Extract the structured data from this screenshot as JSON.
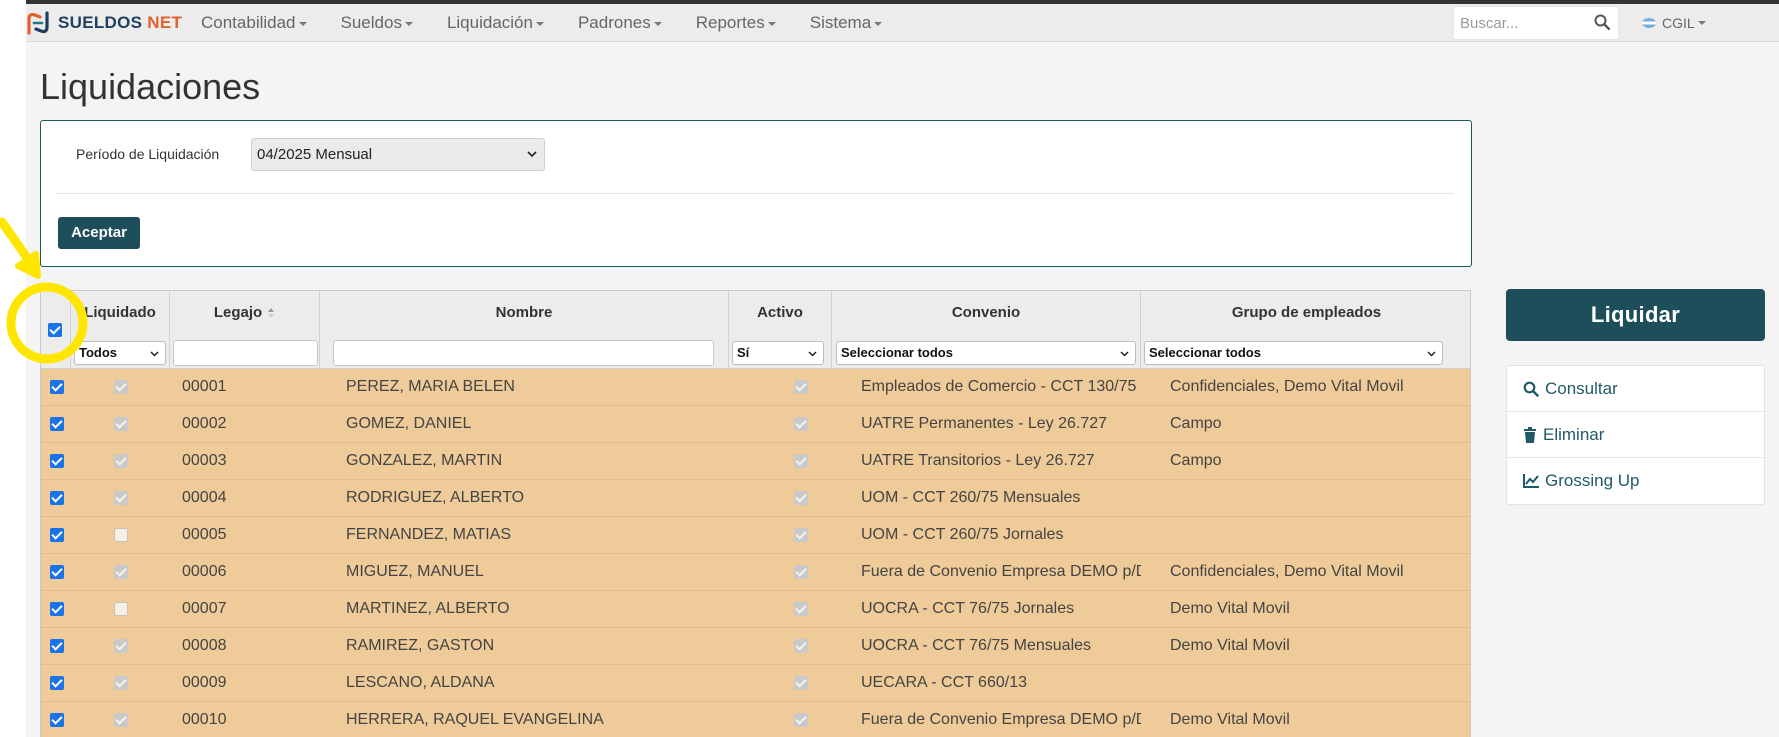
{
  "navbar": {
    "logo_part1": "SUELDOS",
    "logo_part2": " NET",
    "menu": [
      {
        "label": "Contabilidad"
      },
      {
        "label": "Sueldos"
      },
      {
        "label": "Liquidación"
      },
      {
        "label": "Padrones"
      },
      {
        "label": "Reportes"
      },
      {
        "label": "Sistema"
      }
    ],
    "search_placeholder": "Buscar...",
    "user_label": "CGIL"
  },
  "page": {
    "title": "Liquidaciones"
  },
  "filter": {
    "period_label": "Período de Liquidación",
    "period_value": "04/2025 Mensual",
    "accept_label": "Aceptar"
  },
  "table": {
    "headers": {
      "liquidado": "Liquidado",
      "legajo": "Legajo",
      "nombre": "Nombre",
      "activo": "Activo",
      "convenio": "Convenio",
      "grupo": "Grupo de empleados"
    },
    "filters": {
      "liquidado": "Todos",
      "activo": "Sí",
      "convenio": "Seleccionar todos",
      "grupo": "Seleccionar todos"
    },
    "rows": [
      {
        "selected": true,
        "liquidado": true,
        "legajo": "00001",
        "nombre": "PEREZ, MARIA BELEN",
        "activo": true,
        "convenio": "Empleados de Comercio - CCT 130/75",
        "grupo": "Confidenciales, Demo Vital Movil"
      },
      {
        "selected": true,
        "liquidado": true,
        "legajo": "00002",
        "nombre": "GOMEZ, DANIEL",
        "activo": true,
        "convenio": "UATRE Permanentes - Ley 26.727",
        "grupo": "Campo"
      },
      {
        "selected": true,
        "liquidado": true,
        "legajo": "00003",
        "nombre": "GONZALEZ, MARTIN",
        "activo": true,
        "convenio": "UATRE Transitorios - Ley 26.727",
        "grupo": "Campo"
      },
      {
        "selected": true,
        "liquidado": true,
        "legajo": "00004",
        "nombre": "RODRIGUEZ, ALBERTO",
        "activo": true,
        "convenio": "UOM - CCT 260/75 Mensuales",
        "grupo": ""
      },
      {
        "selected": true,
        "liquidado": false,
        "legajo": "00005",
        "nombre": "FERNANDEZ, MATIAS",
        "activo": true,
        "convenio": "UOM - CCT 260/75 Jornales",
        "grupo": ""
      },
      {
        "selected": true,
        "liquidado": true,
        "legajo": "00006",
        "nombre": "MIGUEZ, MANUEL",
        "activo": true,
        "convenio": "Fuera de Convenio Empresa DEMO p/Demo",
        "grupo": "Confidenciales, Demo Vital Movil"
      },
      {
        "selected": true,
        "liquidado": false,
        "legajo": "00007",
        "nombre": "MARTINEZ, ALBERTO",
        "activo": true,
        "convenio": "UOCRA - CCT 76/75 Jornales",
        "grupo": "Demo Vital Movil"
      },
      {
        "selected": true,
        "liquidado": true,
        "legajo": "00008",
        "nombre": "RAMIREZ, GASTON",
        "activo": true,
        "convenio": "UOCRA - CCT 76/75 Mensuales",
        "grupo": "Demo Vital Movil"
      },
      {
        "selected": true,
        "liquidado": true,
        "legajo": "00009",
        "nombre": "LESCANO, ALDANA",
        "activo": true,
        "convenio": "UECARA - CCT 660/13",
        "grupo": ""
      },
      {
        "selected": true,
        "liquidado": true,
        "legajo": "00010",
        "nombre": "HERRERA, RAQUEL EVANGELINA",
        "activo": true,
        "convenio": "Fuera de Convenio Empresa DEMO p/Demo",
        "grupo": "Demo Vital Movil"
      }
    ]
  },
  "sidebar": {
    "liquidar_label": "Liquidar",
    "actions": [
      {
        "label": "Consultar",
        "icon": "search-icon"
      },
      {
        "label": "Eliminar",
        "icon": "trash-icon"
      },
      {
        "label": "Grossing Up",
        "icon": "line-chart-icon"
      }
    ]
  },
  "colors": {
    "primary": "#1d4e5a",
    "row_highlight": "#eecb98",
    "annotation": "#ffe600",
    "checkbox": "#1a73e8"
  }
}
